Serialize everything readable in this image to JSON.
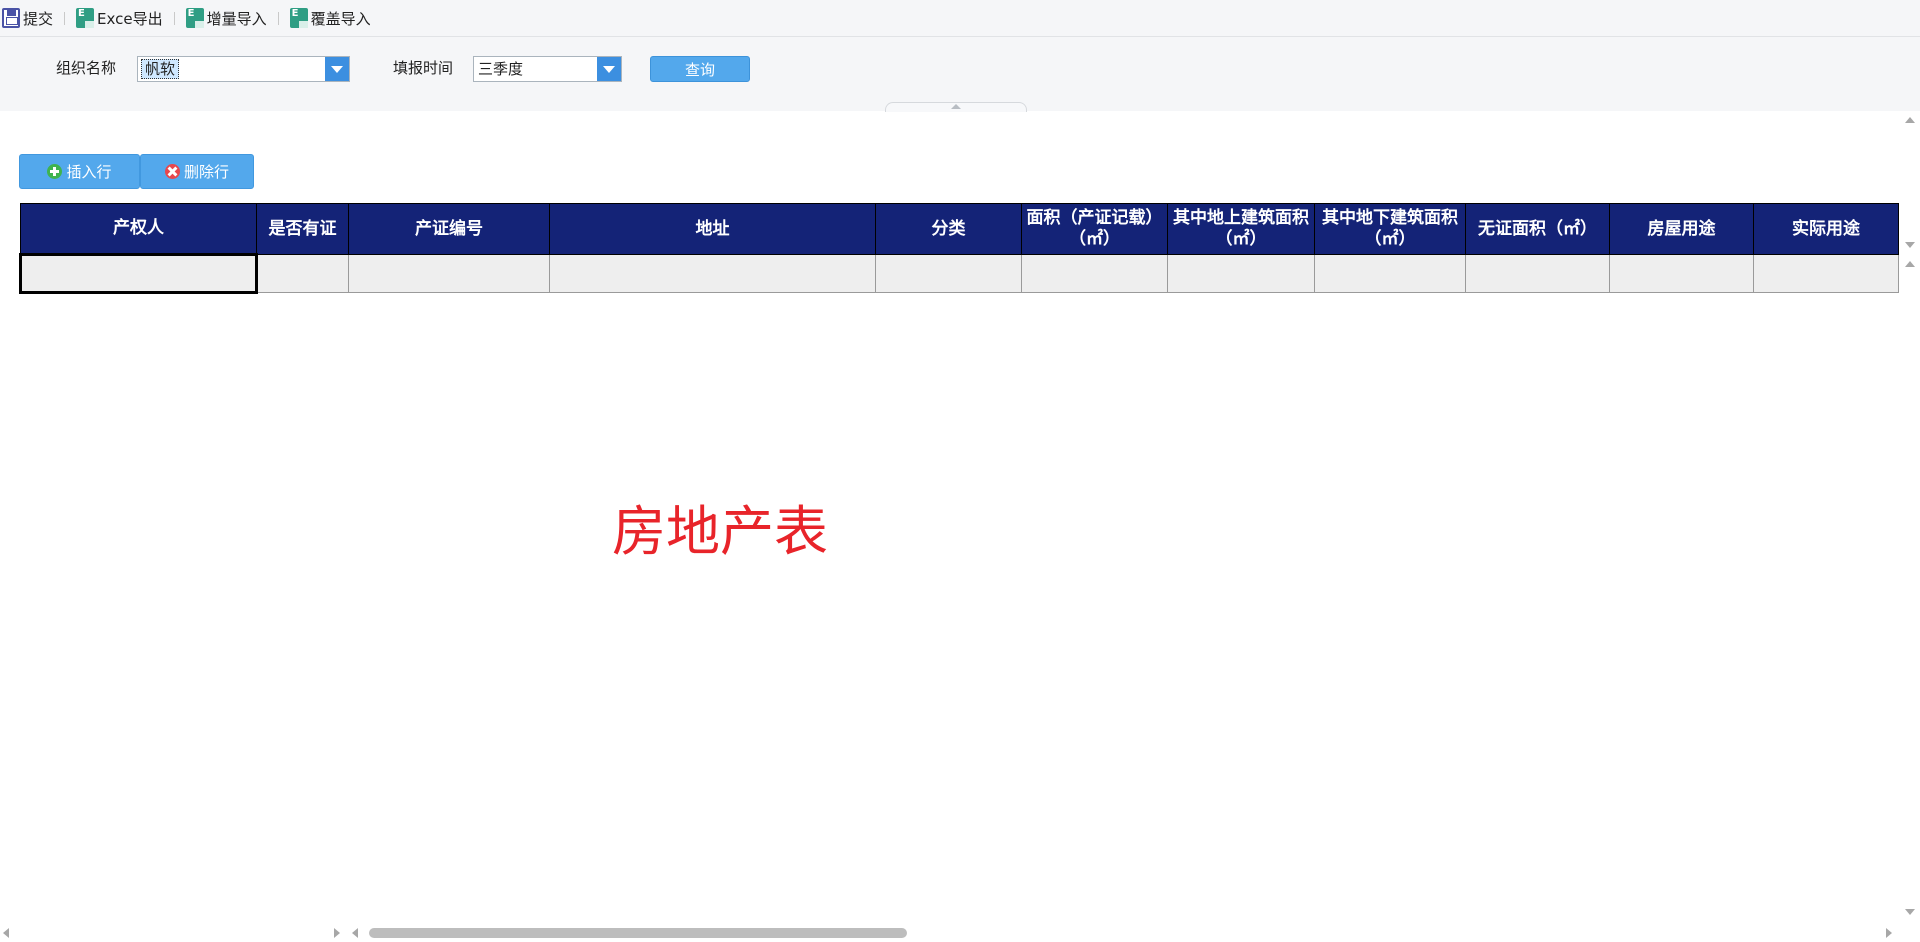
{
  "toolbar": {
    "submit": "提交",
    "excel_export": "Exce导出",
    "incremental_import": "增量导入",
    "overwrite_import": "覆盖导入"
  },
  "query": {
    "org_label": "组织名称",
    "org_value": "帆软",
    "period_label": "填报时间",
    "period_value": "三季度",
    "query_button": "查询"
  },
  "actions": {
    "insert_row": "插入行",
    "delete_row": "删除行"
  },
  "table": {
    "headers": [
      "产权人",
      "是否有证",
      "产证编号",
      "地址",
      "分类",
      "面积（产证记载）（㎡）",
      "其中地上建筑面积（㎡）",
      "其中地下建筑面积（㎡）",
      "无证面积（㎡）",
      "房屋用途",
      "实际用途"
    ]
  },
  "watermark": "房地产表"
}
